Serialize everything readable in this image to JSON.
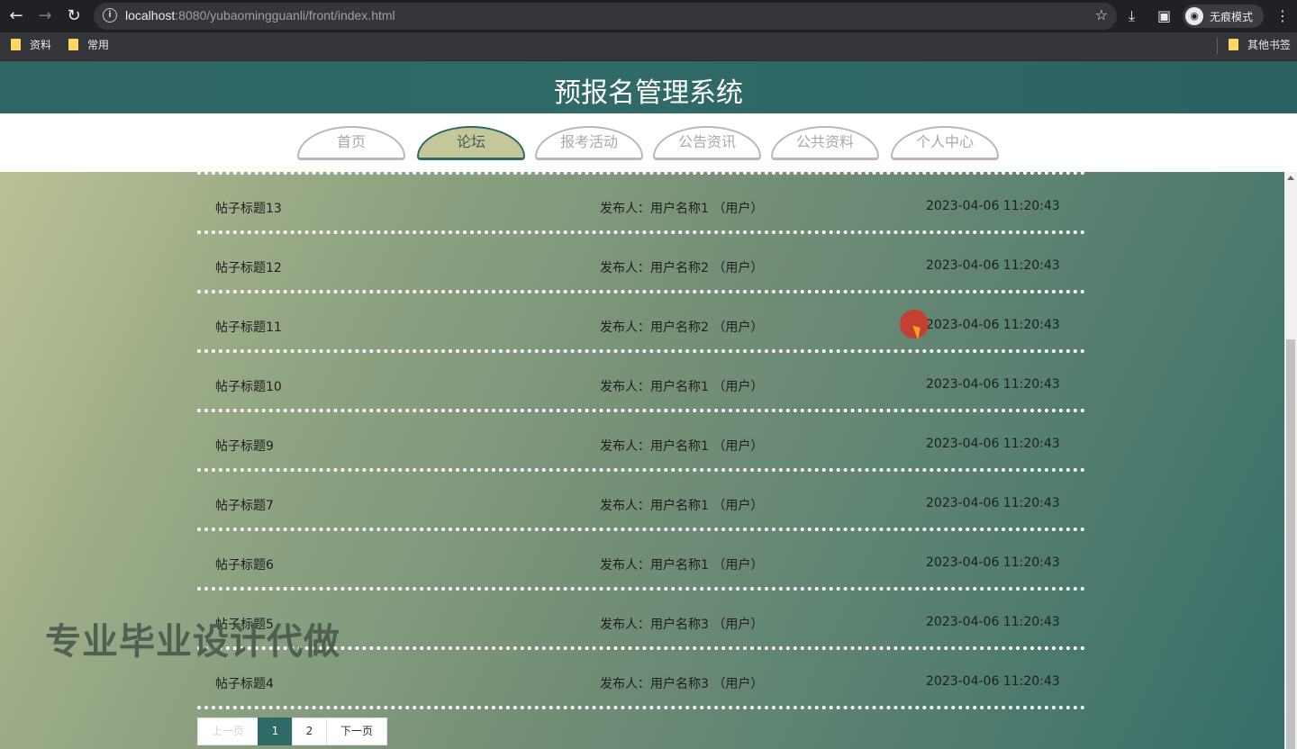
{
  "browser": {
    "url_host": "localhost",
    "url_path": ":8080/yubaomingguanli/front/index.html",
    "profile_label": "无痕模式",
    "bookmarks": [
      "资料",
      "常用"
    ],
    "other_bookmarks": "其他书签"
  },
  "site": {
    "title": "预报名管理系统",
    "nav": [
      {
        "label": "首页",
        "active": false
      },
      {
        "label": "论坛",
        "active": true
      },
      {
        "label": "报考活动",
        "active": false
      },
      {
        "label": "公告资讯",
        "active": false
      },
      {
        "label": "公共资料",
        "active": false
      },
      {
        "label": "个人中心",
        "active": false
      }
    ]
  },
  "posts": [
    {
      "title": "帖子标题13",
      "author": "发布人：用户名称1 （用户）",
      "date": "2023-04-06 11:20:43"
    },
    {
      "title": "帖子标题12",
      "author": "发布人：用户名称2 （用户）",
      "date": "2023-04-06 11:20:43"
    },
    {
      "title": "帖子标题11",
      "author": "发布人：用户名称2 （用户）",
      "date": "2023-04-06 11:20:43"
    },
    {
      "title": "帖子标题10",
      "author": "发布人：用户名称1 （用户）",
      "date": "2023-04-06 11:20:43"
    },
    {
      "title": "帖子标题9",
      "author": "发布人：用户名称1 （用户）",
      "date": "2023-04-06 11:20:43"
    },
    {
      "title": "帖子标题7",
      "author": "发布人：用户名称1 （用户）",
      "date": "2023-04-06 11:20:43"
    },
    {
      "title": "帖子标题6",
      "author": "发布人：用户名称1 （用户）",
      "date": "2023-04-06 11:20:43"
    },
    {
      "title": "帖子标题5",
      "author": "发布人：用户名称3 （用户）",
      "date": "2023-04-06 11:20:43"
    },
    {
      "title": "帖子标题4",
      "author": "发布人：用户名称3 （用户）",
      "date": "2023-04-06 11:20:43"
    }
  ],
  "pagination": {
    "prev": "上一页",
    "pages": [
      "1",
      "2"
    ],
    "current": "1",
    "next": "下一页"
  },
  "watermark": "专业毕业设计代做",
  "colors": {
    "header": "#2f6a66",
    "active_tab": "#c5c69a",
    "page_gradient_start": "#c0c598",
    "page_gradient_end": "#356e68"
  }
}
